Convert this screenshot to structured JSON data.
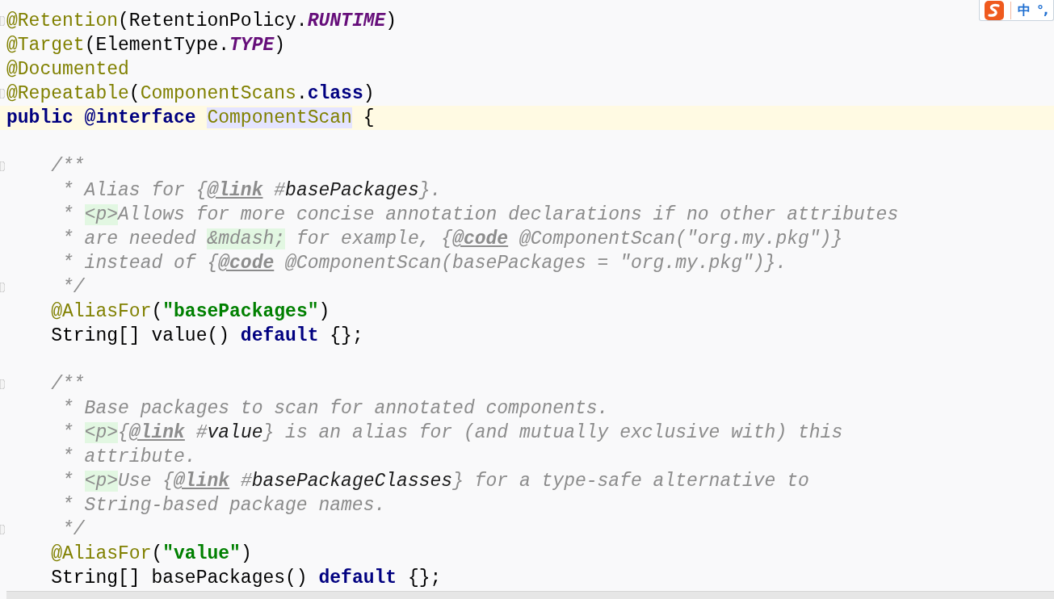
{
  "editor": {
    "lines": [
      {
        "current": false,
        "fold": true,
        "tokens": [
          {
            "kind": "annotation",
            "text": "@Retention"
          },
          {
            "kind": "plain",
            "text": "(RetentionPolicy."
          },
          {
            "kind": "constant",
            "text": "RUNTIME"
          },
          {
            "kind": "plain",
            "text": ")"
          }
        ]
      },
      {
        "current": false,
        "fold": false,
        "tokens": [
          {
            "kind": "annotation",
            "text": "@Target"
          },
          {
            "kind": "plain",
            "text": "(ElementType."
          },
          {
            "kind": "constant",
            "text": "TYPE"
          },
          {
            "kind": "plain",
            "text": ")"
          }
        ]
      },
      {
        "current": false,
        "fold": false,
        "tokens": [
          {
            "kind": "annotation",
            "text": "@Documented"
          }
        ]
      },
      {
        "current": false,
        "fold": true,
        "tokens": [
          {
            "kind": "annotation",
            "text": "@Repeatable"
          },
          {
            "kind": "plain",
            "text": "("
          },
          {
            "kind": "annotation",
            "text": "ComponentScans"
          },
          {
            "kind": "plain",
            "text": "."
          },
          {
            "kind": "keyword",
            "text": "class"
          },
          {
            "kind": "plain",
            "text": ")"
          }
        ]
      },
      {
        "current": true,
        "fold": false,
        "tokens": [
          {
            "kind": "keyword",
            "text": "public @interface "
          },
          {
            "kind": "declaration",
            "text": "ComponentScan"
          },
          {
            "kind": "plain",
            "text": " {"
          }
        ]
      },
      {
        "current": false,
        "fold": false
      },
      {
        "current": false,
        "fold": true,
        "tokens": [
          {
            "kind": "comment",
            "text": "    /**"
          }
        ]
      },
      {
        "current": false,
        "fold": false,
        "tokens": [
          {
            "kind": "comment",
            "text": "     * Alias for {"
          },
          {
            "kind": "doctag",
            "text": "@link"
          },
          {
            "kind": "comment",
            "text": " #"
          },
          {
            "kind": "docref",
            "text": "basePackages"
          },
          {
            "kind": "comment",
            "text": "}."
          }
        ]
      },
      {
        "current": false,
        "fold": false,
        "tokens": [
          {
            "kind": "comment",
            "text": "     * "
          },
          {
            "kind": "html",
            "text": "<p>"
          },
          {
            "kind": "comment",
            "text": "Allows for more concise annotation declarations if no other attributes"
          }
        ]
      },
      {
        "current": false,
        "fold": false,
        "tokens": [
          {
            "kind": "comment",
            "text": "     * are needed "
          },
          {
            "kind": "html",
            "text": "&mdash;"
          },
          {
            "kind": "comment",
            "text": " for example, {"
          },
          {
            "kind": "doctag",
            "text": "@code"
          },
          {
            "kind": "comment",
            "text": " @ComponentScan(\"org.my.pkg\")}"
          }
        ]
      },
      {
        "current": false,
        "fold": false,
        "tokens": [
          {
            "kind": "comment",
            "text": "     * instead of {"
          },
          {
            "kind": "doctag",
            "text": "@code"
          },
          {
            "kind": "comment",
            "text": " @ComponentScan(basePackages = \"org.my.pkg\")}."
          }
        ]
      },
      {
        "current": false,
        "fold": true,
        "tokens": [
          {
            "kind": "comment",
            "text": "     */"
          }
        ]
      },
      {
        "current": false,
        "fold": false,
        "tokens": [
          {
            "kind": "annotation",
            "text": "    @AliasFor"
          },
          {
            "kind": "plain",
            "text": "("
          },
          {
            "kind": "string",
            "text": "\"basePackages\""
          },
          {
            "kind": "plain",
            "text": ")"
          }
        ]
      },
      {
        "current": false,
        "fold": false,
        "tokens": [
          {
            "kind": "plain",
            "text": "    String[] value() "
          },
          {
            "kind": "keyword",
            "text": "default"
          },
          {
            "kind": "plain",
            "text": " {};"
          }
        ]
      },
      {
        "current": false,
        "fold": false
      },
      {
        "current": false,
        "fold": true,
        "tokens": [
          {
            "kind": "comment",
            "text": "    /**"
          }
        ]
      },
      {
        "current": false,
        "fold": false,
        "tokens": [
          {
            "kind": "comment",
            "text": "     * Base packages to scan for annotated components."
          }
        ]
      },
      {
        "current": false,
        "fold": false,
        "tokens": [
          {
            "kind": "comment",
            "text": "     * "
          },
          {
            "kind": "html",
            "text": "<p>"
          },
          {
            "kind": "comment",
            "text": "{"
          },
          {
            "kind": "doctag",
            "text": "@link"
          },
          {
            "kind": "comment",
            "text": " #"
          },
          {
            "kind": "docref",
            "text": "value"
          },
          {
            "kind": "comment",
            "text": "} is an alias for (and mutually exclusive with) this"
          }
        ]
      },
      {
        "current": false,
        "fold": false,
        "tokens": [
          {
            "kind": "comment",
            "text": "     * attribute."
          }
        ]
      },
      {
        "current": false,
        "fold": false,
        "tokens": [
          {
            "kind": "comment",
            "text": "     * "
          },
          {
            "kind": "html",
            "text": "<p>"
          },
          {
            "kind": "comment",
            "text": "Use {"
          },
          {
            "kind": "doctag",
            "text": "@link"
          },
          {
            "kind": "comment",
            "text": " #"
          },
          {
            "kind": "docref",
            "text": "basePackageClasses"
          },
          {
            "kind": "comment",
            "text": "} for a type-safe alternative to"
          }
        ]
      },
      {
        "current": false,
        "fold": false,
        "tokens": [
          {
            "kind": "comment",
            "text": "     * String-based package names."
          }
        ]
      },
      {
        "current": false,
        "fold": true,
        "tokens": [
          {
            "kind": "comment",
            "text": "     */"
          }
        ]
      },
      {
        "current": false,
        "fold": false,
        "tokens": [
          {
            "kind": "annotation",
            "text": "    @AliasFor"
          },
          {
            "kind": "plain",
            "text": "("
          },
          {
            "kind": "string",
            "text": "\"value\""
          },
          {
            "kind": "plain",
            "text": ")"
          }
        ]
      },
      {
        "current": false,
        "fold": false,
        "tokens": [
          {
            "kind": "plain",
            "text": "    String[] basePackages() "
          },
          {
            "kind": "keyword",
            "text": "default"
          },
          {
            "kind": "plain",
            "text": " {};"
          }
        ]
      }
    ]
  },
  "ime_toolbar": {
    "items": [
      "中",
      "°,"
    ]
  }
}
